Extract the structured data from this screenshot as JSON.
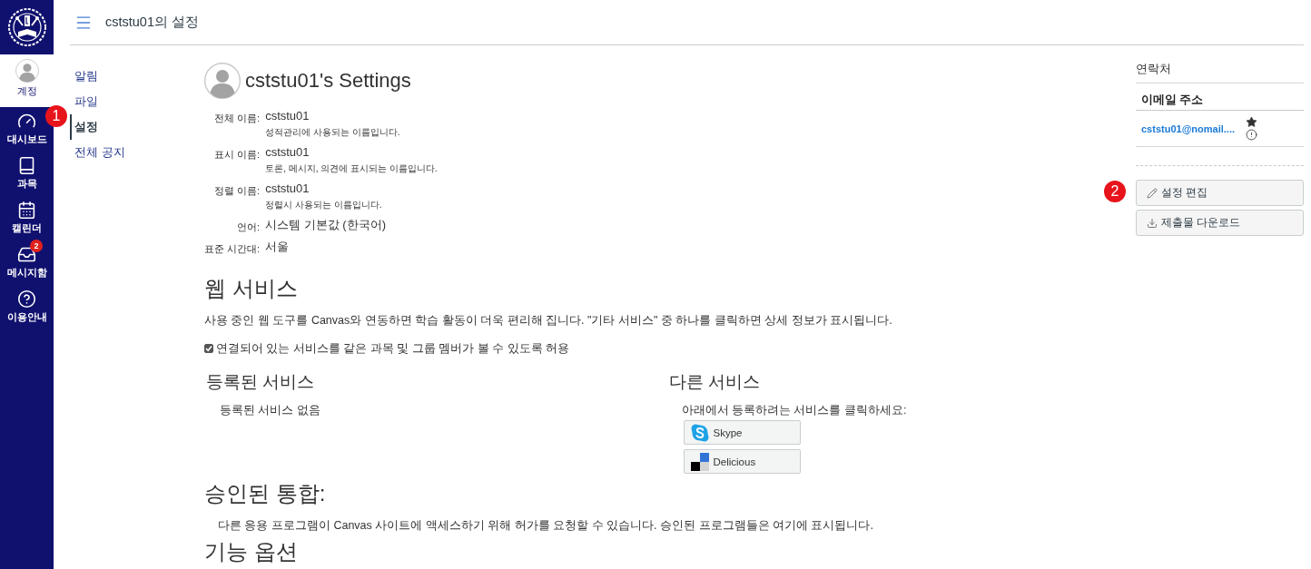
{
  "global_nav": {
    "account": {
      "label": "계정",
      "selected": true
    },
    "items": [
      {
        "label": "대시보드",
        "selected": false
      },
      {
        "label": "과목",
        "selected": false
      },
      {
        "label": "캘린더",
        "selected": false
      },
      {
        "label": "메시지함",
        "selected": false,
        "badge": "2"
      },
      {
        "label": "이용안내",
        "selected": false
      }
    ]
  },
  "header": {
    "title": "cststu01의 설정"
  },
  "sub_nav": {
    "items": [
      {
        "label": "알림",
        "selected": false
      },
      {
        "label": "파일",
        "selected": false
      },
      {
        "label": "설정",
        "selected": true
      },
      {
        "label": "전체 공지",
        "selected": false
      }
    ]
  },
  "profile": {
    "title": "cststu01's Settings",
    "fields": [
      {
        "label": "전체 이름:",
        "value": "cststu01",
        "hint": "성적관리에 사용되는 이름입니다."
      },
      {
        "label": "표시 이름:",
        "value": "cststu01",
        "hint": "토론, 메시지, 의견에 표시되는 이름입니다."
      },
      {
        "label": "정렬 이름:",
        "value": "cststu01",
        "hint": "정렬시 사용되는 이름입니다."
      },
      {
        "label": "언어:",
        "value": "시스템 기본값 (한국어)"
      },
      {
        "label": "표준 시간대:",
        "value": "서울"
      }
    ]
  },
  "web_services": {
    "heading": "웹 서비스",
    "description": "사용 중인 웹 도구를 Canvas와 연동하면 학습 활동이 더욱 편리해 집니다. \"기타 서비스\" 중 하나를 클릭하면 상세 정보가 표시됩니다.",
    "visibility_option": {
      "label": "연결되어 있는 서비스를 같은 과목 및 그룹 멤버가 볼 수 있도록 허용",
      "checked": true
    },
    "registered": {
      "heading": "등록된 서비스",
      "empty_text": "등록된 서비스 없음"
    },
    "other": {
      "heading": "다른 서비스",
      "instruction": "아래에서 등록하려는 서비스를 클릭하세요:",
      "services": [
        {
          "label": "Skype"
        },
        {
          "label": "Delicious"
        }
      ]
    }
  },
  "approved_integrations": {
    "heading": "승인된 통합:",
    "description": "다른 응용 프로그램이 Canvas 사이트에 액세스하기 위해 허가를 요청할 수 있습니다. 승인된 프로그램들은 여기에 표시됩니다."
  },
  "feature_options": {
    "heading": "기능 옵션"
  },
  "contacts": {
    "heading": "연락처",
    "column": "이메일 주소",
    "emails": [
      {
        "address": "cststu01@nomail...."
      }
    ]
  },
  "actions": [
    {
      "label": "설정 편집"
    },
    {
      "label": "제출물 다운로드"
    }
  ],
  "annotations": [
    {
      "label": "1"
    },
    {
      "label": "2"
    }
  ]
}
